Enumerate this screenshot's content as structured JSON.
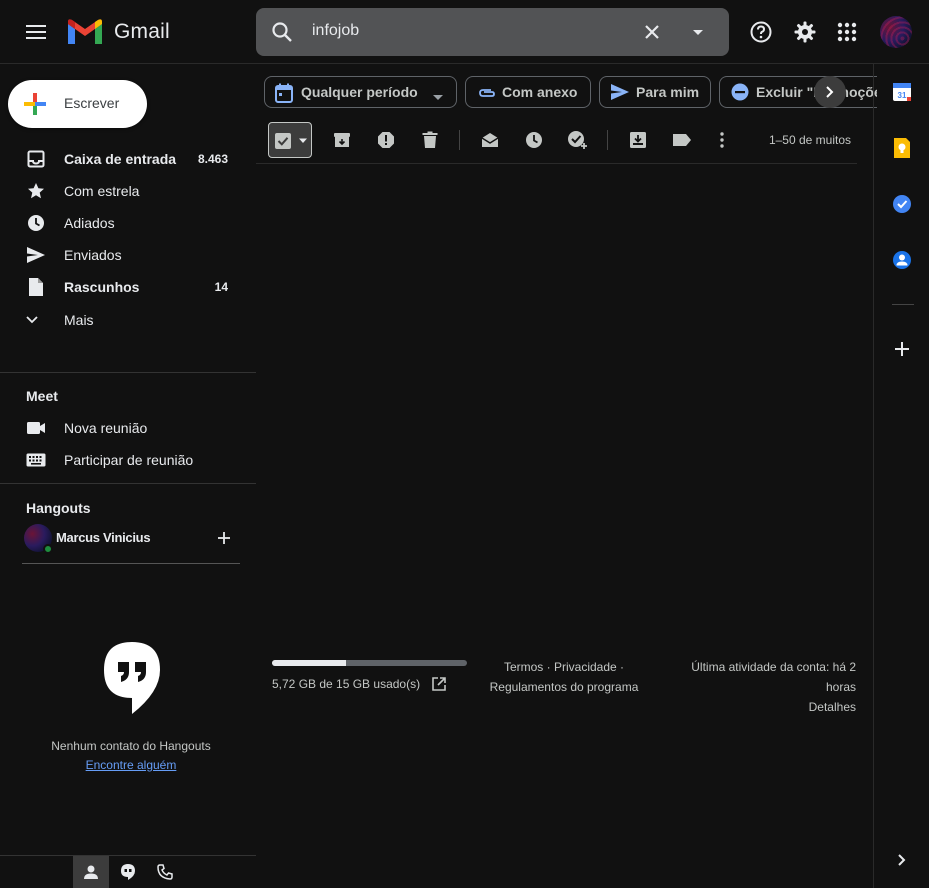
{
  "app": {
    "name": "Gmail"
  },
  "search": {
    "value": "infojob"
  },
  "compose": {
    "label": "Escrever"
  },
  "nav": [
    {
      "label": "Caixa de entrada",
      "count": "8.463",
      "bold": true,
      "icon": "inbox-icon"
    },
    {
      "label": "Com estrela",
      "count": "",
      "bold": false,
      "icon": "star-icon"
    },
    {
      "label": "Adiados",
      "count": "",
      "bold": false,
      "icon": "clock-icon"
    },
    {
      "label": "Enviados",
      "count": "",
      "bold": false,
      "icon": "send-icon"
    },
    {
      "label": "Rascunhos",
      "count": "14",
      "bold": true,
      "icon": "draft-icon"
    },
    {
      "label": "Mais",
      "count": "",
      "bold": false,
      "icon": "chevron-down-icon"
    }
  ],
  "meet": {
    "title": "Meet",
    "items": [
      {
        "label": "Nova reunião",
        "icon": "video-icon"
      },
      {
        "label": "Participar de reunião",
        "icon": "keyboard-icon"
      }
    ]
  },
  "hangouts": {
    "title": "Hangouts",
    "user": "Marcus Vinicius",
    "empty_text": "Nenhum contato do Hangouts",
    "find_link": "Encontre alguém"
  },
  "chips": [
    {
      "label": "Qualquer período",
      "icon": "calendar-icon",
      "caret": true
    },
    {
      "label": "Com anexo",
      "icon": "paperclip-icon",
      "caret": false
    },
    {
      "label": "Para mim",
      "icon": "send-icon",
      "caret": false
    },
    {
      "label": "Excluir \"Promoções",
      "icon": "minus-circle-icon",
      "caret": false
    }
  ],
  "toolbar": {
    "pager": "1–50 de muitos"
  },
  "footer": {
    "storage_text": "5,72 GB de 15 GB usado(s)",
    "storage_used_fraction": 0.38,
    "terms": "Termos",
    "privacy": "Privacidade",
    "policies": "Regulamentos do programa",
    "activity_line1": "Última atividade da conta: há 2",
    "activity_line2": "horas",
    "details": "Detalhes"
  },
  "side_apps": [
    {
      "name": "calendar-app-icon",
      "label": "31",
      "color": "#4285f4"
    },
    {
      "name": "keep-app-icon",
      "color": "#fbbc04"
    },
    {
      "name": "tasks-app-icon",
      "color": "#4285f4"
    },
    {
      "name": "contacts-app-icon",
      "color": "#1a73e8"
    }
  ],
  "colors": {
    "background": "#111111",
    "search_bg": "#525355",
    "accent_blue": "#8ab4f8",
    "link_blue": "#669df6",
    "online_green": "#1e8e3e"
  }
}
